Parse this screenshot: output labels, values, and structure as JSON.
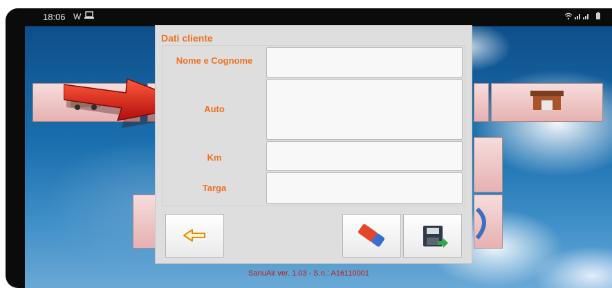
{
  "status_bar": {
    "time": "18:06",
    "left_icons": [
      "W",
      "laptop-icon"
    ],
    "right_icons": [
      "wifi-icon",
      "signal-icon",
      "signal-icon",
      "battery-icon"
    ]
  },
  "background_tiles": [
    {
      "name": "car-tile",
      "icon": "car-icon"
    },
    {
      "name": "garage-tile",
      "icon": "garage-icon"
    }
  ],
  "dialog": {
    "title": "Dati cliente",
    "fields": [
      {
        "label": "Nome e Cognome",
        "value": ""
      },
      {
        "label": "Auto",
        "value": ""
      },
      {
        "label": "Km",
        "value": ""
      },
      {
        "label": "Targa",
        "value": ""
      }
    ],
    "buttons": {
      "back_icon": "arrow-left-icon",
      "clear_icon": "eraser-icon",
      "save_icon": "floppy-save-icon"
    }
  },
  "footer_text": "SanuAir ver. 1.03 - S.n.: A16110001",
  "colors": {
    "label_orange": "#f07020",
    "footer_red": "#c01818",
    "tile_pink": "#e6b1b1",
    "dialog_gray": "#dedede"
  }
}
